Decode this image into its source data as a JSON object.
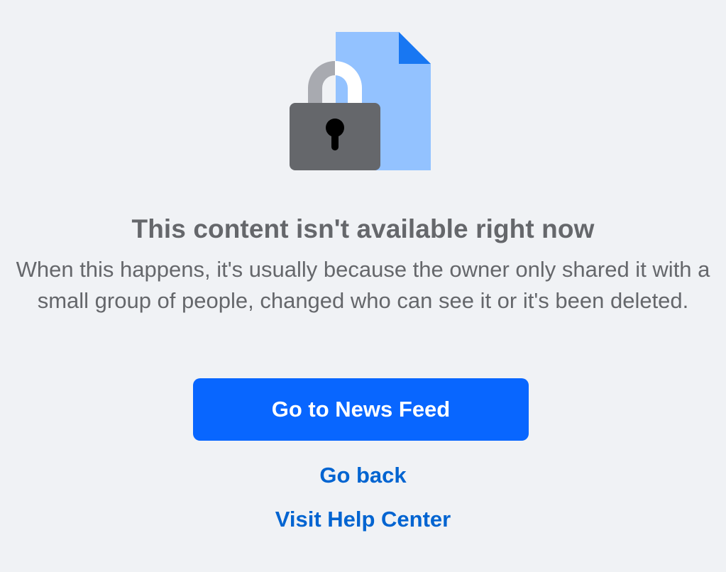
{
  "colors": {
    "background": "#f0f2f5",
    "text_secondary": "#65676b",
    "primary_button": "#0866ff",
    "link": "#0064d1",
    "document": "#93c2ff",
    "document_fold": "#1877f2",
    "lock_body": "#65676b",
    "lock_shackle_left": "#a8aab0",
    "lock_shackle_right": "#ffffff"
  },
  "illustration": {
    "icon": "locked-document-icon"
  },
  "message": {
    "title": "This content isn't available right now",
    "body": "When this happens, it's usually because the owner only shared it with a small group of people, changed who can see it or it's been deleted."
  },
  "actions": {
    "primary_label": "Go to News Feed",
    "back_label": "Go back",
    "help_label": "Visit Help Center"
  }
}
